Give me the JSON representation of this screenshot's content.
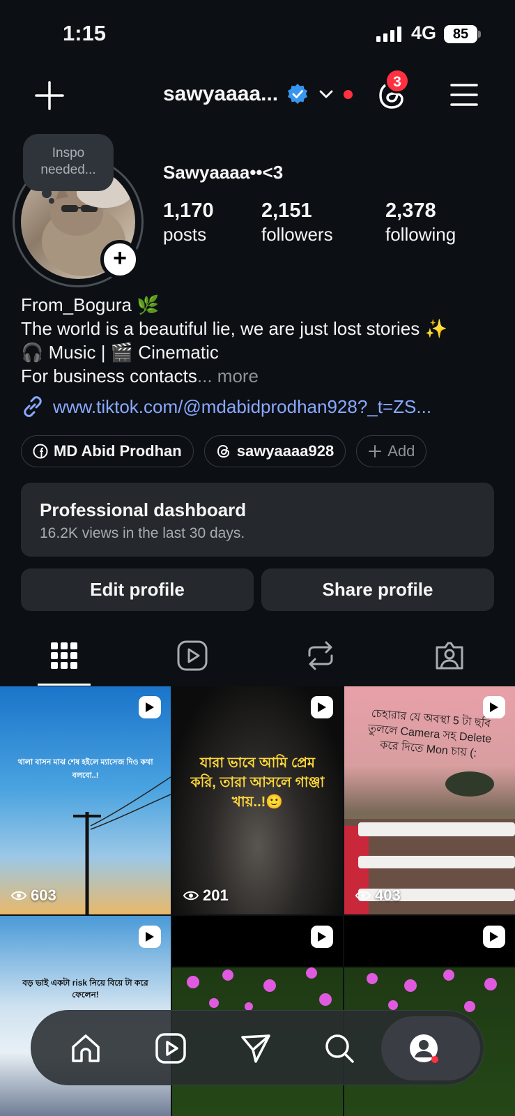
{
  "status_bar": {
    "time": "1:15",
    "network": "4G",
    "battery": "85"
  },
  "header": {
    "username": "sawyaaaa...",
    "threads_badge": "3",
    "icons": [
      "plus-icon",
      "verified-icon",
      "chevron-down-icon",
      "threads-icon",
      "menu-icon"
    ]
  },
  "profile": {
    "note": "Inspo needed...",
    "display_name": "Sawyaaaa••<3",
    "stats": [
      {
        "value": "1,170",
        "label": "posts"
      },
      {
        "value": "2,151",
        "label": "followers"
      },
      {
        "value": "2,378",
        "label": "following"
      }
    ],
    "bio_lines": [
      "From_Bogura 🌿",
      "The world is a beautiful lie, we are just lost stories ✨",
      "🎧 Music | 🎬 Cinematic",
      "For business contacts"
    ],
    "bio_more": "... more",
    "link": "www.tiktok.com/@mdabidprodhan928?_t=ZS..."
  },
  "chips": [
    {
      "label": "MD Abid Prodhan",
      "icon": "facebook-icon"
    },
    {
      "label": "sawyaaaa928",
      "icon": "threads-icon"
    },
    {
      "label": "Add",
      "icon": "plus-icon"
    }
  ],
  "dashboard": {
    "title": "Professional dashboard",
    "subtitle": "16.2K views in the last 30 days."
  },
  "buttons": {
    "edit": "Edit profile",
    "share": "Share profile"
  },
  "tabs": [
    "grid-icon",
    "reels-icon",
    "reposts-icon",
    "tagged-icon"
  ],
  "posts": [
    {
      "views": "603",
      "caption": "থালা বাসন মাঝ শেষ হইলে ম্যাসেজ দিও কথা বলবো..!"
    },
    {
      "views": "201",
      "caption": "যারা ভাবে আমি প্রেম করি, তারা আসলে গাঞ্জা খায়..!🙂"
    },
    {
      "views": "403",
      "caption": "চেহারার যে অবস্থা 5 টা ছবি তুললে Camera সহ Delete করে দিতে Mon চায় (:"
    },
    {
      "views": "",
      "caption": "বড় ভাই একটা risk নিয়ে বিয়ে টা করে ফেলেন!"
    },
    {
      "views": "",
      "caption": ""
    },
    {
      "views": "",
      "caption": ""
    }
  ],
  "bottom_nav": [
    "home-icon",
    "reels-icon",
    "messages-icon",
    "search-icon",
    "profile-icon"
  ],
  "colors": {
    "background": "#0c1014",
    "link": "#8aa8ff",
    "card": "#25292e",
    "badge": "#ff3040",
    "verified": "#3797f0"
  }
}
